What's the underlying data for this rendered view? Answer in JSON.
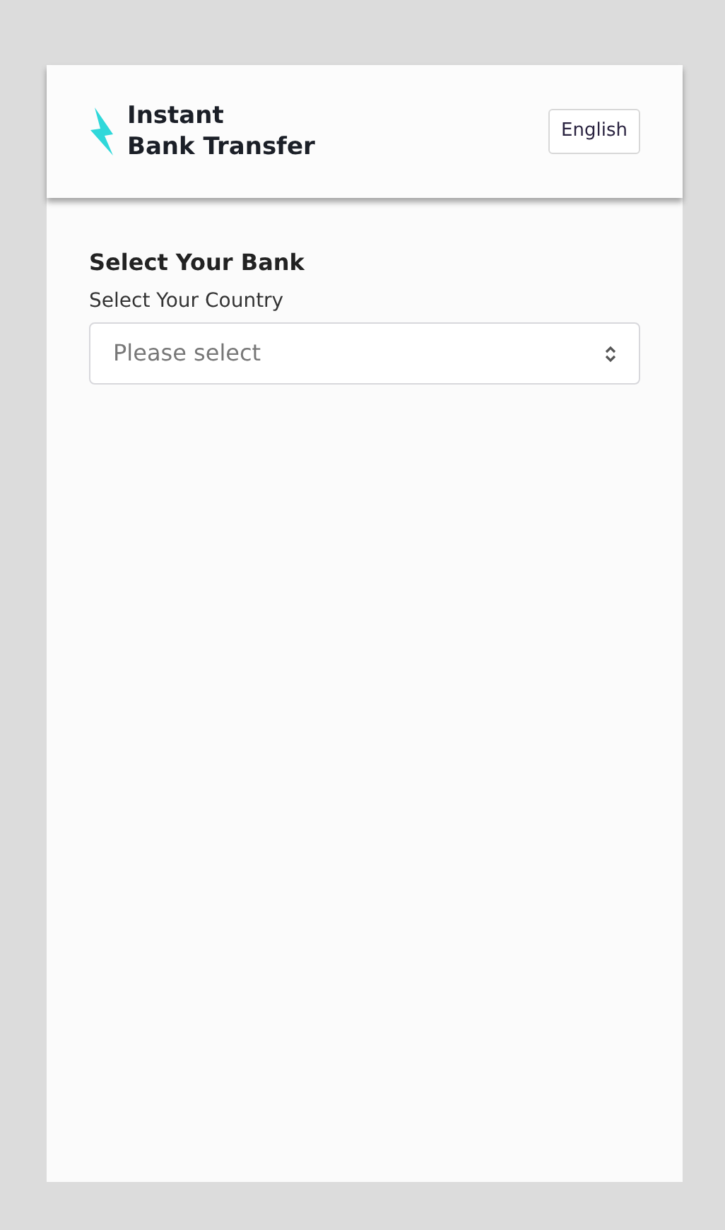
{
  "header": {
    "brand": [
      "Instant",
      "Bank Transfer"
    ],
    "language_button": "English"
  },
  "form": {
    "title": "Select Your Bank",
    "country_label": "Select Your Country",
    "country_select": {
      "placeholder": "Please select"
    }
  }
}
